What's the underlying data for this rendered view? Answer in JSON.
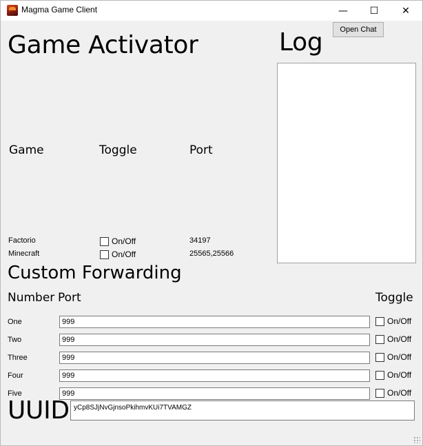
{
  "window": {
    "title": "Magma Game Client",
    "controls": {
      "minimize": "—",
      "maximize": "☐",
      "close": "✕"
    }
  },
  "activator": {
    "heading": "Game Activator",
    "columns": {
      "game": "Game",
      "toggle": "Toggle",
      "port": "Port"
    },
    "games": [
      {
        "name": "Factorio",
        "toggle_label": "On/Off",
        "port": "34197"
      },
      {
        "name": "Minecraft",
        "toggle_label": "On/Off",
        "port": "25565,25566"
      }
    ]
  },
  "log": {
    "heading": "Log",
    "open_chat_label": "Open Chat"
  },
  "forwarding": {
    "heading": "Custom Forwarding",
    "columns": {
      "number": "Number",
      "port": "Port",
      "toggle": "Toggle"
    },
    "rows": [
      {
        "label": "One",
        "value": "999",
        "toggle_label": "On/Off"
      },
      {
        "label": "Two",
        "value": "999",
        "toggle_label": "On/Off"
      },
      {
        "label": "Three",
        "value": "999",
        "toggle_label": "On/Off"
      },
      {
        "label": "Four",
        "value": "999",
        "toggle_label": "On/Off"
      },
      {
        "label": "Five",
        "value": "999",
        "toggle_label": "On/Off"
      }
    ]
  },
  "uuid": {
    "label": "UUID",
    "value": "yCp8SJjNvGjnsoPkihmvKUi7TVAMGZ"
  }
}
